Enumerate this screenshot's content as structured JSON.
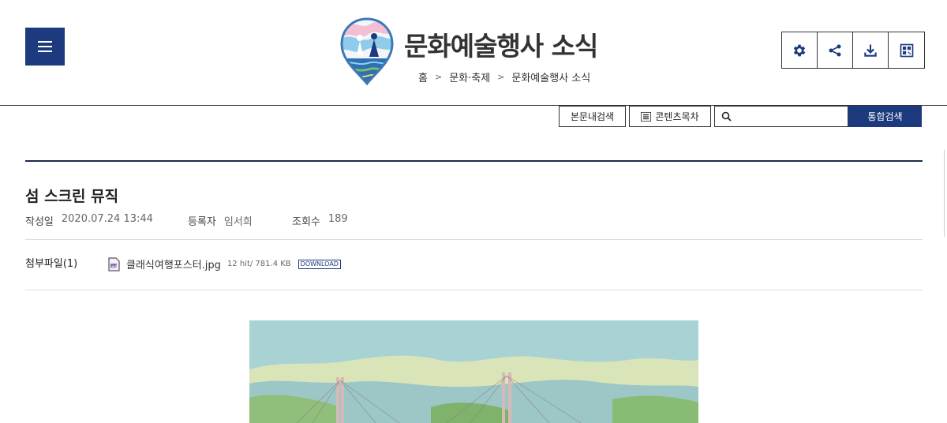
{
  "header": {
    "site_title": "문화예술행사 소식",
    "menu_icon": "hamburger-menu-icon",
    "breadcrumb": [
      "홈",
      "문화·축제",
      "문화예술행사 소식"
    ],
    "tools": [
      {
        "name": "settings",
        "icon": "gear-icon"
      },
      {
        "name": "share",
        "icon": "share-icon"
      },
      {
        "name": "download",
        "icon": "download-icon"
      },
      {
        "name": "print",
        "icon": "qr-code-icon"
      }
    ]
  },
  "search": {
    "content_search_label": "본문내검색",
    "toc_label": "콘텐츠목차",
    "input_value": "",
    "input_placeholder": "",
    "submit_label": "통합검색"
  },
  "post": {
    "title": "섬 스크린 뮤직",
    "meta": {
      "date_label": "작성일",
      "date_value": "2020.07.24 13:44",
      "author_label": "등록자",
      "author_value": "임서희",
      "views_label": "조회수",
      "views_value": "189"
    },
    "attachment": {
      "label": "첨부파일(1)",
      "file_name": "클래식여행포스터.jpg",
      "file_info": "12 hit/ 781.4 KB",
      "download_label": "DOWNLOAD"
    }
  },
  "colors": {
    "brand_navy": "#1c3a7d",
    "text": "#222222",
    "rule": "#1a2b4a"
  }
}
